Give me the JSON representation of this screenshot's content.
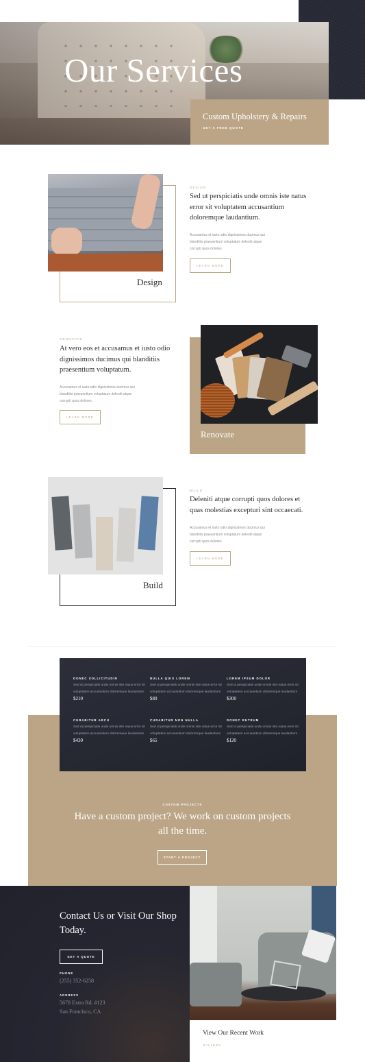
{
  "hero": {
    "title": "Our Services",
    "subtitle": "Custom Upholstery & Repairs",
    "cta": "GET A FREE QUOTE"
  },
  "services": [
    {
      "category": "DESIGN",
      "heading": "Sed ut perspiciatis unde omnis iste natus error sit voluptatem accusantium doloremque laudantium.",
      "body": "Accusamus et iusto odio dignissimos ducimus qui blanditiis praesentium voluptatum deleniti atque corrupti quos dolores.",
      "button": "LEARN MORE",
      "label": "Design"
    },
    {
      "category": "RENOVATE",
      "heading": "At vero eos et accusamus et iusto odio dignissimos ducimus qui blanditiis praesentium voluptatum.",
      "body": "Accusamus et iusto odio dignissimos ducimus qui blanditiis praesentium voluptatum deleniti atque corrupti quos dolores.",
      "button": "LEARN MORE",
      "label": "Renovate"
    },
    {
      "category": "BUILD",
      "heading": "Deleniti atque corrupti quos dolores et quas molestias excepturi sint occaecati.",
      "body": "Accusamus et iusto odio dignissimos ducimus qui blanditiis praesentium voluptatum deleniti atque corrupti quos dolores.",
      "button": "LEARN MORE",
      "label": "Build"
    }
  ],
  "pricing": [
    {
      "title": "DONEC SOLLICITUDIN",
      "desc": "Sed ut perspiciatis unde omnis iste natus error sit voluptatem accusantium doloremque laudantium",
      "price": "$210"
    },
    {
      "title": "NULLA QUIS LOREM",
      "desc": "Sed ut perspiciatis unde omnis iste natus error sit voluptatem accusantium doloremque laudantium",
      "price": "$80"
    },
    {
      "title": "LOREM IPSUM DOLOR",
      "desc": "Sed ut perspiciatis unde omnis iste natus error sit voluptatem accusantium doloremque laudantium",
      "price": "$300"
    },
    {
      "title": "CURABITUR ARCU",
      "desc": "Sed ut perspiciatis unde omnis iste natus error sit voluptatem accusantium doloremque laudantium",
      "price": "$430"
    },
    {
      "title": "CURABITUR NON NULLA",
      "desc": "Sed ut perspiciatis unde omnis iste natus error sit voluptatem accusantium doloremque laudantium",
      "price": "$65"
    },
    {
      "title": "DONEC RUTRUM",
      "desc": "Sed ut perspiciatis unde omnis iste natus error sit voluptatem accusantium doloremque laudantium",
      "price": "$120"
    }
  ],
  "custom_project": {
    "category": "CUSTOM PROJECTS",
    "heading": "Have a custom project? We work on custom projects all the time.",
    "button": "START A PROJECT"
  },
  "contact": {
    "heading": "Contact Us or Visit Our Shop Today.",
    "button": "GET A QUOTE",
    "phone_label": "PHONE",
    "phone": "(255) 352-6258",
    "address_label": "ADDRESS",
    "address_line1": "5678 Extra Rd. #123",
    "address_line2": "San Francisco, CA"
  },
  "gallery": {
    "title": "View Our Recent Work",
    "link": "GALLERY"
  },
  "colors": {
    "accent_tan": "#bba586",
    "dark_navy": "#21222b",
    "white": "#ffffff"
  }
}
